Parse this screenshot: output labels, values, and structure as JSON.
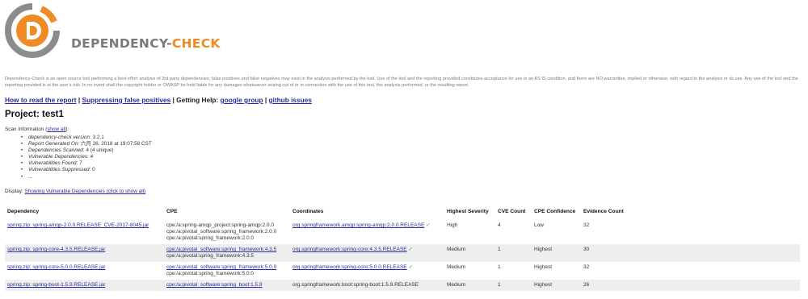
{
  "brand": {
    "part1": "DEPENDENCY-",
    "part2": "CHECK",
    "colors": {
      "orange": "#f08a24",
      "gray": "#7a7a7a"
    }
  },
  "disclaimer": "Dependency-Check is an open source tool performing a best effort analysis of 3rd party dependencies; false positives and false negatives may exist in the analysis performed by the tool. Use of the tool and the reporting provided constitutes acceptance for use in an AS IS condition, and there are NO warranties, implied or otherwise, with regard to the analysis or its use. Any use of the tool and the reporting provided is at the user's risk. In no event shall the copyright holder or OWASP be held liable for any damages whatsoever arising out of or in connection with the use of this tool, the analysis performed, or the resulting report.",
  "links": {
    "how_to_read": "How to read the report",
    "sep1": " | ",
    "suppressing": "Suppressing false positives",
    "help_prefix": " | Getting Help: ",
    "google_group": "google group",
    "sep2": " | ",
    "github_issues": "github issues"
  },
  "project_title": "Project: test1",
  "scan_info": {
    "label": "Scan Information (",
    "show_all": "show all",
    "close": "):"
  },
  "stats": [
    {
      "label": "dependency-check version",
      "value": ": 3.2.1"
    },
    {
      "label": "Report Generated On",
      "value": ": 六月 26, 2018 at 19:07:58 CST"
    },
    {
      "label": "Dependencies Scanned",
      "value": ": 4 (4 unique)"
    },
    {
      "label": "Vulnerable Dependencies",
      "value": ": 4"
    },
    {
      "label": "Vulnerabilities Found",
      "value": ": 7"
    },
    {
      "label": "Vulnerabilities Suppressed",
      "value": ": 0"
    },
    {
      "label": "...",
      "value": ""
    }
  ],
  "display": {
    "label": "Display: ",
    "link": "Showing Vulnerable Dependencies (click to show all)"
  },
  "table": {
    "headers": [
      "Dependency",
      "CPE",
      "Coordinates",
      "Highest Severity",
      "CVE Count",
      "CPE Confidence",
      "Evidence Count"
    ],
    "rows": [
      {
        "dependency": "spring.zip: spring-amqp-2.0.0.RELEASE_CVE-2017-8045.jar",
        "cpe_linked": "",
        "cpe_plain": [
          "cpe:/a:spring-amqp_project:spring-amqp:2.0.0",
          "cpe:/a:pivotal_software:spring_framework:2.0.0",
          "cpe:/a:pivotal:spring_framework:2.0.0"
        ],
        "coordinates": "org.springframework.amqp:spring-amqp:2.0.0.RELEASE",
        "coordinates_link": true,
        "check": "✓",
        "severity": "High",
        "cve_count": "4",
        "confidence": "Low",
        "evidence": "32"
      },
      {
        "dependency": "spring.zip: spring-core-4.3.5.RELEASE.jar",
        "cpe_linked": "cpe:/a:pivotal_software:spring_framework:4.3.5",
        "cpe_plain": [
          "cpe:/a:pivotal:spring_framework:4.3.5"
        ],
        "coordinates": "org.springframework:spring-core:4.3.5.RELEASE",
        "coordinates_link": true,
        "check": "✓",
        "severity": "Medium",
        "cve_count": "1",
        "confidence": "Highest",
        "evidence": "30"
      },
      {
        "dependency": "spring.zip: spring-core-5.0.0.RELEASE.jar",
        "cpe_linked": "cpe:/a:pivotal_software:spring_framework:5.0.0",
        "cpe_plain": [
          "cpe:/a:pivotal:spring_framework:5.0.0"
        ],
        "coordinates": "org.springframework:spring-core:5.0.0.RELEASE",
        "coordinates_link": true,
        "check": "✓",
        "severity": "Medium",
        "cve_count": "1",
        "confidence": "Highest",
        "evidence": "32"
      },
      {
        "dependency": "spring.zip: spring-boot-1.5.9.RELEASE.jar",
        "cpe_linked": "cpe:/a:pivotal_software:spring_boot:1.5.9",
        "cpe_plain": [],
        "coordinates": "org.springframework.boot:spring-boot:1.5.9.RELEASE",
        "coordinates_link": false,
        "check": "",
        "severity": "Medium",
        "cve_count": "1",
        "confidence": "Highest",
        "evidence": "26"
      }
    ]
  }
}
